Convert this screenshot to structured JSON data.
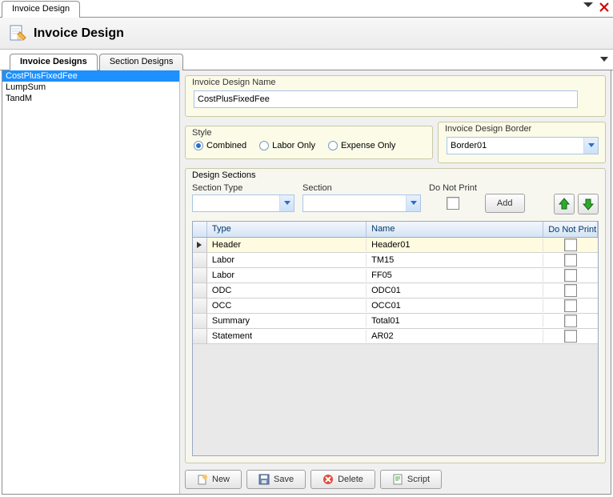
{
  "window": {
    "tab_title": "Invoice Design"
  },
  "header": {
    "title": "Invoice Design"
  },
  "inner_tabs": {
    "designs": "Invoice Designs",
    "sections": "Section Designs"
  },
  "sidebar": {
    "items": [
      {
        "label": "CostPlusFixedFee",
        "selected": true
      },
      {
        "label": "LumpSum",
        "selected": false
      },
      {
        "label": "TandM",
        "selected": false
      }
    ]
  },
  "name_panel": {
    "legend": "Invoice Design Name",
    "value": "CostPlusFixedFee"
  },
  "style_panel": {
    "legend": "Style",
    "options": {
      "combined": "Combined",
      "labor": "Labor Only",
      "expense": "Expense Only"
    },
    "selected": "combined"
  },
  "border_panel": {
    "legend": "Invoice Design Border",
    "value": "Border01"
  },
  "sections_panel": {
    "legend": "Design Sections",
    "section_type_label": "Section Type",
    "section_label": "Section",
    "dnp_label": "Do Not Print",
    "add_label": "Add",
    "grid": {
      "headers": {
        "type": "Type",
        "name": "Name",
        "dnp": "Do Not Print"
      },
      "rows": [
        {
          "type": "Header",
          "name": "Header01",
          "dnp": false,
          "selected": true
        },
        {
          "type": "Labor",
          "name": "TM15",
          "dnp": false,
          "selected": false
        },
        {
          "type": "Labor",
          "name": "FF05",
          "dnp": false,
          "selected": false
        },
        {
          "type": "ODC",
          "name": "ODC01",
          "dnp": false,
          "selected": false
        },
        {
          "type": "OCC",
          "name": "OCC01",
          "dnp": false,
          "selected": false
        },
        {
          "type": "Summary",
          "name": "Total01",
          "dnp": false,
          "selected": false
        },
        {
          "type": "Statement",
          "name": "AR02",
          "dnp": false,
          "selected": false
        }
      ]
    }
  },
  "toolbar": {
    "new": "New",
    "save": "Save",
    "delete": "Delete",
    "script": "Script"
  }
}
